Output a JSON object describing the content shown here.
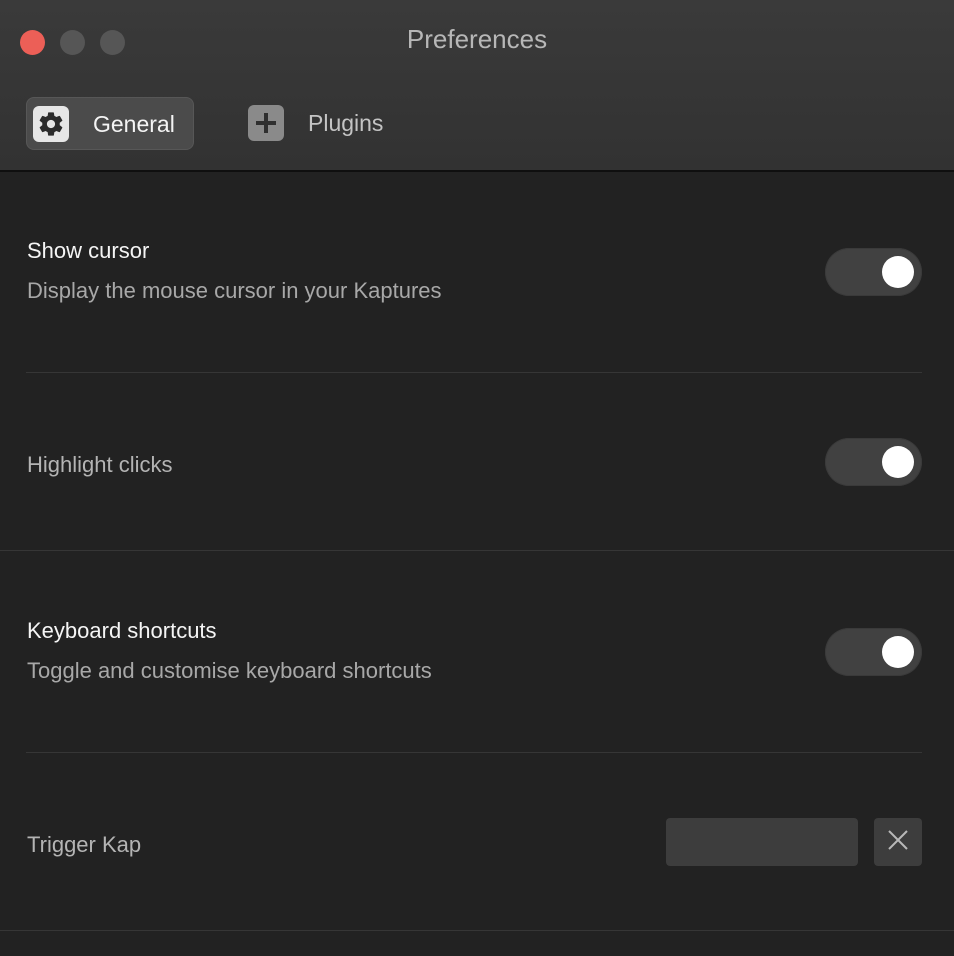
{
  "window": {
    "title": "Preferences",
    "traffic_lights": {
      "close_color": "#ec5f57",
      "minimize_color": "#565656",
      "maximize_color": "#565656"
    }
  },
  "tabs": [
    {
      "label": "General",
      "icon": "gear-icon",
      "selected": true
    },
    {
      "label": "Plugins",
      "icon": "plus-icon",
      "selected": false
    }
  ],
  "settings": {
    "show_cursor": {
      "title": "Show cursor",
      "description": "Display the mouse cursor in your Kaptures",
      "enabled": true
    },
    "highlight_clicks": {
      "title": "Highlight clicks",
      "enabled": true
    },
    "keyboard_shortcuts": {
      "title": "Keyboard shortcuts",
      "description": "Toggle and customise keyboard shortcuts",
      "enabled": true
    },
    "trigger_kap": {
      "title": "Trigger Kap",
      "shortcut_value": "",
      "clear_icon": "close-icon"
    }
  },
  "colors": {
    "toggle_track": "#414141",
    "toggle_knob": "#ffffff"
  }
}
